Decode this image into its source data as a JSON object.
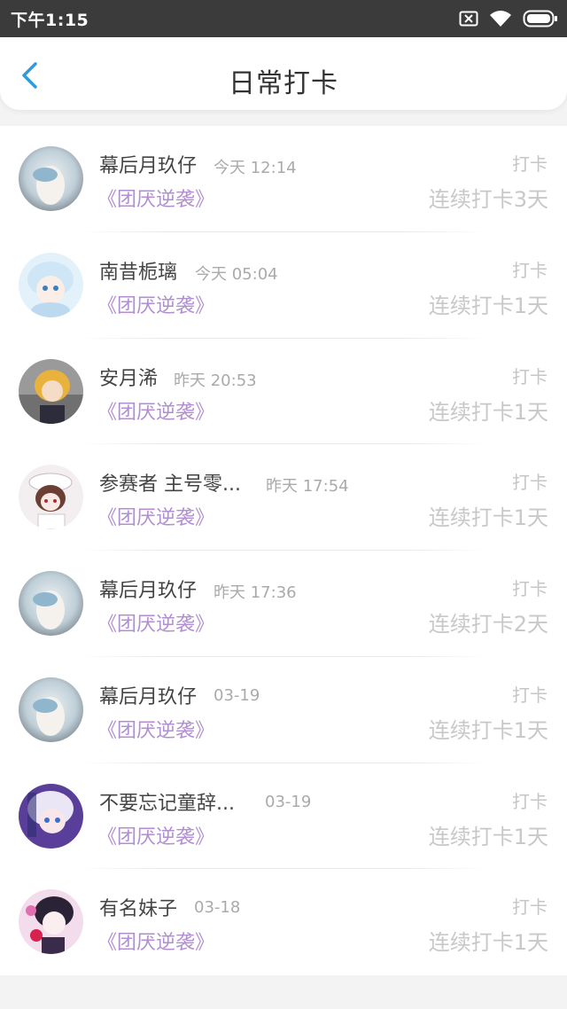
{
  "status_bar": {
    "time": "下午1:15",
    "icons": [
      "sim-blocked-icon",
      "wifi-icon",
      "battery-icon"
    ]
  },
  "header": {
    "title": "日常打卡",
    "back_icon": "chevron-left-icon",
    "accent_color": "#2d9be0"
  },
  "colors": {
    "book_title": "#b18fd2",
    "muted_text": "#c8c8c8",
    "status_bar_bg": "#3b3b3b"
  },
  "checkins": [
    {
      "username": "幕后月玖仔",
      "time": "今天 12:14",
      "book": "《团厌逆袭》",
      "action": "打卡",
      "streak": "连续打卡3天"
    },
    {
      "username": "南昔栀璃",
      "time": "今天 05:04",
      "book": "《团厌逆袭》",
      "action": "打卡",
      "streak": "连续打卡1天"
    },
    {
      "username": "安月浠",
      "time": "昨天 20:53",
      "book": "《团厌逆袭》",
      "action": "打卡",
      "streak": "连续打卡1天"
    },
    {
      "username": "参赛者 主号零...",
      "time": "昨天 17:54",
      "book": "《团厌逆袭》",
      "action": "打卡",
      "streak": "连续打卡1天"
    },
    {
      "username": "幕后月玖仔",
      "time": "昨天 17:36",
      "book": "《团厌逆袭》",
      "action": "打卡",
      "streak": "连续打卡2天"
    },
    {
      "username": "幕后月玖仔",
      "time": "03-19",
      "book": "《团厌逆袭》",
      "action": "打卡",
      "streak": "连续打卡1天"
    },
    {
      "username": "不要忘记童辞...",
      "time": "03-19",
      "book": "《团厌逆袭》",
      "action": "打卡",
      "streak": "连续打卡1天"
    },
    {
      "username": "有名妹子",
      "time": "03-18",
      "book": "《团厌逆袭》",
      "action": "打卡",
      "streak": "连续打卡1天"
    }
  ]
}
